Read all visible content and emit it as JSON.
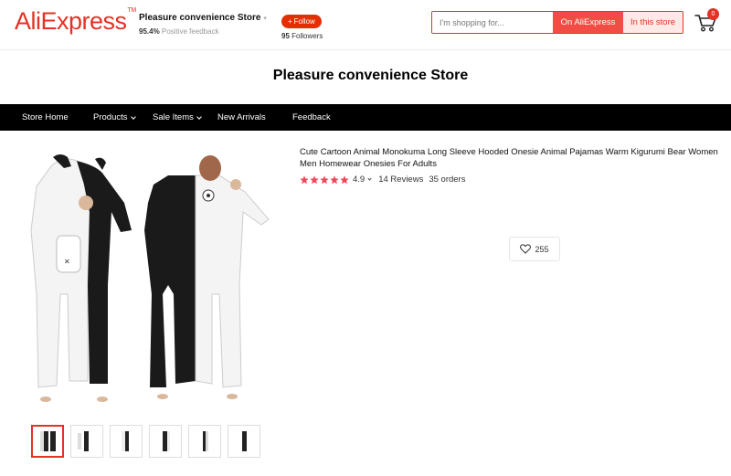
{
  "header": {
    "logo_text": "AliExpress",
    "logo_tm": "TM",
    "store_name": "Pleasure convenience Store",
    "positive_percent": "95.4%",
    "positive_label": "Positive feedback",
    "follow_label": "Follow",
    "followers_count": "95",
    "followers_label": "Followers",
    "search_placeholder": "I'm shopping for...",
    "search_all_label": "On AliExpress",
    "search_store_label": "In this store",
    "cart_count": "0"
  },
  "banner": {
    "title": "Pleasure convenience Store"
  },
  "nav": {
    "items": [
      {
        "label": "Store Home",
        "dropdown": false
      },
      {
        "label": "Products",
        "dropdown": true
      },
      {
        "label": "Sale Items",
        "dropdown": true
      },
      {
        "label": "New Arrivals",
        "dropdown": false
      },
      {
        "label": "Feedback",
        "dropdown": false
      }
    ]
  },
  "product": {
    "title": "Cute Cartoon Animal Monokuma Long Sleeve Hooded Onesie Animal Pajamas Warm Kigurumi Bear Women Men Homewear Onesies For Adults",
    "rating": "4.9",
    "stars": 5,
    "reviews": "14 Reviews",
    "orders": "35 orders",
    "wishlist_count": "255"
  },
  "colors": {
    "brand": "#e43225",
    "star": "#f0485a",
    "nav_bg": "#000000"
  },
  "icons": {
    "cart": "cart-icon",
    "heart": "heart-icon",
    "star": "star-icon",
    "plus": "plus-icon"
  }
}
